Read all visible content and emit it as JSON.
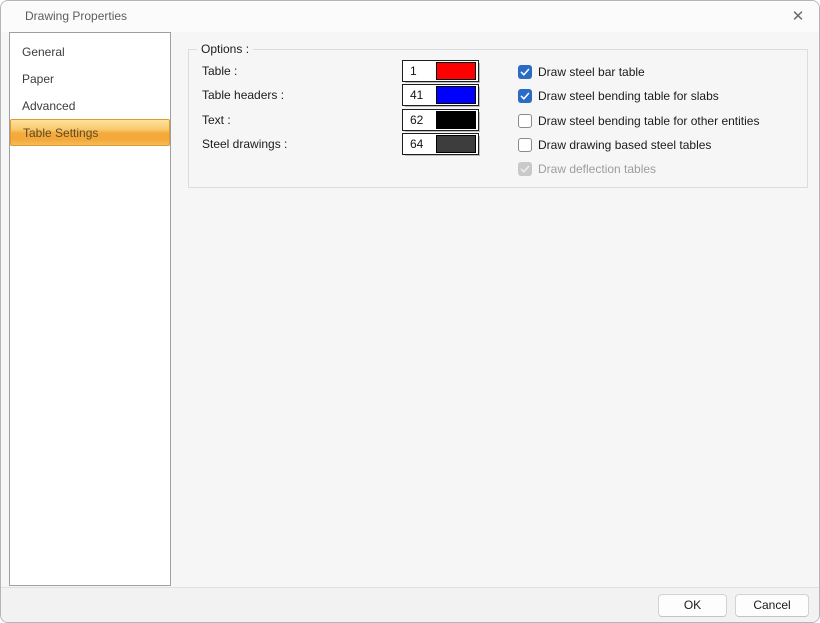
{
  "window": {
    "title": "Drawing Properties",
    "close_icon": "✕"
  },
  "sidebar": {
    "items": [
      {
        "label": "General",
        "selected": false
      },
      {
        "label": "Paper",
        "selected": false
      },
      {
        "label": "Advanced",
        "selected": false
      },
      {
        "label": "Table Settings",
        "selected": true
      }
    ]
  },
  "options": {
    "group_label": "Options :",
    "color_rows": [
      {
        "label": "Table :",
        "value": "1",
        "color": "#ff0000"
      },
      {
        "label": "Table headers :",
        "value": "41",
        "color": "#0000ff"
      },
      {
        "label": "Text :",
        "value": "62",
        "color": "#000000"
      },
      {
        "label": "Steel drawings :",
        "value": "64",
        "color": "#3d3d3d"
      }
    ],
    "checkboxes": [
      {
        "label": "Draw steel bar table",
        "checked": true,
        "disabled": false
      },
      {
        "label": "Draw steel bending table for slabs",
        "checked": true,
        "disabled": false
      },
      {
        "label": "Draw steel bending table for other entities",
        "checked": false,
        "disabled": false
      },
      {
        "label": "Draw drawing based steel tables",
        "checked": false,
        "disabled": false
      },
      {
        "label": "Draw deflection tables",
        "checked": true,
        "disabled": true
      }
    ]
  },
  "footer": {
    "ok_label": "OK",
    "cancel_label": "Cancel"
  },
  "colors": {
    "checkbox_accent": "#2a6bc6",
    "selected_nav_border": "#dd9a33",
    "selected_nav_gradient_top": "#fde29c",
    "selected_nav_gradient_bottom": "#f7bd58"
  }
}
